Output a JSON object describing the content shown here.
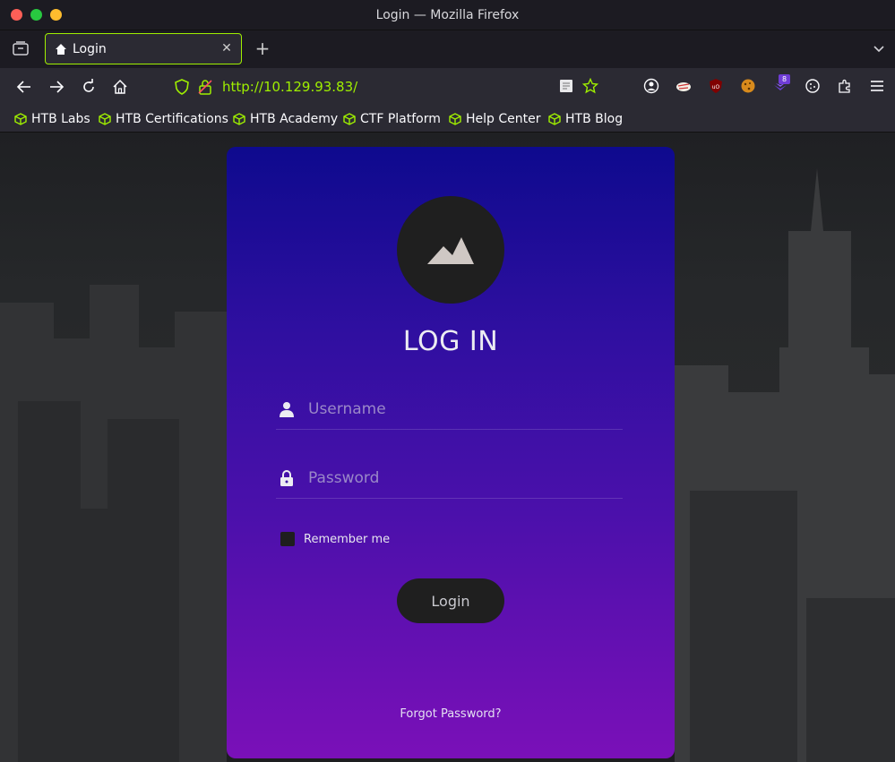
{
  "window": {
    "title": "Login — Mozilla Firefox"
  },
  "tabs": [
    {
      "label": "Login",
      "icon": "home-icon"
    }
  ],
  "navbar": {
    "url": "http://10.129.93.83/"
  },
  "bookmarks": [
    {
      "label": "HTB Labs"
    },
    {
      "label": "HTB Certifications"
    },
    {
      "label": "HTB Academy"
    },
    {
      "label": "CTF Platform"
    },
    {
      "label": "Help Center"
    },
    {
      "label": "HTB Blog"
    }
  ],
  "extensions": {
    "badge_count": "8"
  },
  "login": {
    "heading": "LOG IN",
    "username_placeholder": "Username",
    "password_placeholder": "Password",
    "remember_label": "Remember me",
    "button_label": "Login",
    "forgot_label": "Forgot Password?"
  },
  "colors": {
    "accent": "#9fef00",
    "card_top": "#0e0a8e",
    "card_bottom": "#7a10b8"
  }
}
